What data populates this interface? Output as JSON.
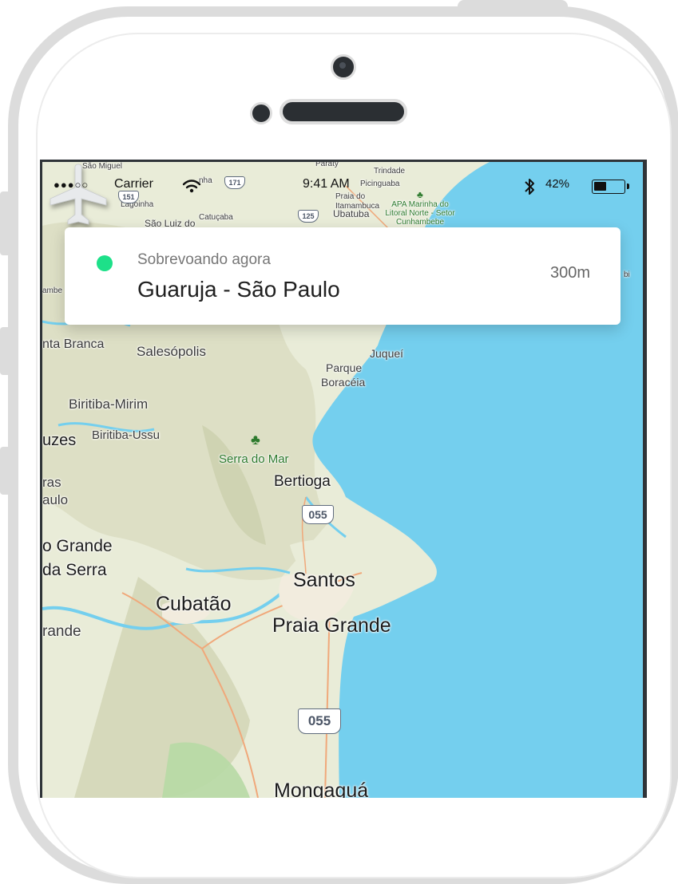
{
  "status_bar": {
    "signal": "●●●○○",
    "carrier": "Carrier",
    "time": "9:41 AM",
    "battery_percent": "42%",
    "battery_level": 0.42,
    "wifi_icon": "wifi-icon",
    "bluetooth_icon": "bluetooth-icon"
  },
  "flight_card": {
    "status_label": "Sobrevoando agora",
    "location": "Guaruja - São Paulo",
    "altitude": "300m",
    "status_color": "#1de089"
  },
  "map": {
    "water_color": "#74cfee",
    "land_color": "#e9ecd8",
    "labels": {
      "sao_miguel": "São Miguel",
      "paraty": "Paraty",
      "trindade": "Trindade",
      "picinguaba": "Picinguaba",
      "praia_do_itamambuca": "Praia do Itamambuca",
      "ubatuba": "Ubatuba",
      "apa": "APA Marinha do Litoral Norte - Setor Cunhambebe",
      "lagoinha": "Lagoinha",
      "sao_luiz": "São Luiz do",
      "catucaba": "Catuçaba",
      "nha": "nha",
      "ambe": "ambe",
      "bi": "bi",
      "anta_branca": "nta Branca",
      "salesopolis": "Salesópolis",
      "juquei": "Juqueí",
      "parque": "Parque",
      "boraceia": "Boracéia",
      "biritiba_mirim": "Biritiba-Mirim",
      "biritiba_ussu": "Biritiba-Ussu",
      "uzes": "uzes",
      "serra_do_mar": "Serra do Mar",
      "bertioga": "Bertioga",
      "ras": "ras",
      "aulo": "aulo",
      "o_grande": "o Grande",
      "da_serra": "da Serra",
      "santos": "Santos",
      "cubatao": "Cubatão",
      "praia_grande": "Praia Grande",
      "rande": "rande",
      "mongagua": "Mongaguá"
    },
    "shields": {
      "r151": "151",
      "r171": "171",
      "r125": "125",
      "r055_top": "055",
      "r055_bottom": "055"
    }
  }
}
